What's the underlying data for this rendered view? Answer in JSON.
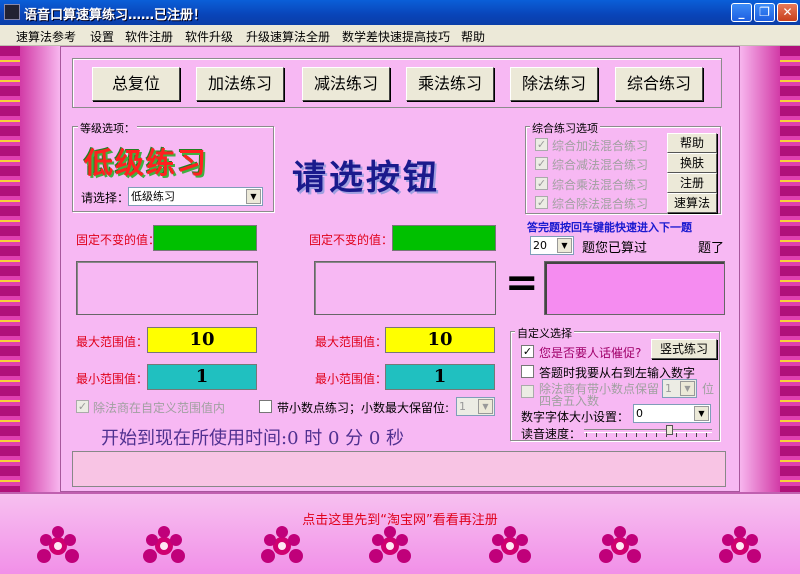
{
  "window": {
    "title": "语音口算速算练习……已注册！"
  },
  "menu": [
    "速算法参考",
    "设置",
    "软件注册",
    "软件升级",
    "升级速算法全册",
    "数学差快速提高技巧",
    "帮助"
  ],
  "top_buttons": [
    "总复位",
    "加法练习",
    "减法练习",
    "乘法练习",
    "除法练习",
    "综合练习"
  ],
  "level": {
    "group_label": "等级选项：",
    "banner": "低级练习",
    "select_label": "请选择：",
    "select_value": "低级练习"
  },
  "prompt": "请选按钮",
  "mixed": {
    "group_label": "综合练习选项",
    "options": [
      "综合加法混合练习",
      "综合减法混合练习",
      "综合乘法混合练习",
      "综合除法混合练习"
    ],
    "buttons": [
      "帮助",
      "换肤",
      "注册",
      "速算法"
    ]
  },
  "enter_hint": "答完题按回车键能快速进入下一题",
  "count": {
    "value": "20",
    "text1": "题您已算过",
    "text2": "题了"
  },
  "left_operand": {
    "fixed_label": "固定不变的值：",
    "max_label": "最大范围值：",
    "max_value": "10",
    "min_label": "最小范围值：",
    "min_value": "1"
  },
  "right_operand": {
    "fixed_label": "固定不变的值：",
    "max_label": "最大范围值：",
    "max_value": "10",
    "min_label": "最小范围值：",
    "min_value": "1"
  },
  "equals": "=",
  "divide_option": "除法商在自定义范围值内",
  "decimal_option": "带小数点练习；小数最大保留位:",
  "decimal_value": "1",
  "timer_text": "开始到现在所使用时间:0 时 0 分 0 秒",
  "custom": {
    "group_label": "自定义选择",
    "urge_label": "您是否要人话催促?",
    "vertical_button": "竖式练习",
    "rtl_label": "答题时我要从右到左输入数字",
    "decimal_keep_label": "除法商有带小数点保留",
    "decimal_keep_value": "1",
    "decimal_keep_suffix": "位",
    "round_label": "四舍五入数",
    "font_size_label": "数字字体大小设置：",
    "font_size_value": "0",
    "speed_label": "读音速度："
  },
  "bottom_link": "点击这里先到“淘宝网”看看再注册",
  "colors": {
    "green": "#00c000",
    "yellow": "#ffff00",
    "teal": "#20c0c0",
    "pink": "#f7b8f3",
    "magenta_box": "#f58cf0",
    "red": "#e0001a",
    "navy": "#1a1a8c"
  }
}
